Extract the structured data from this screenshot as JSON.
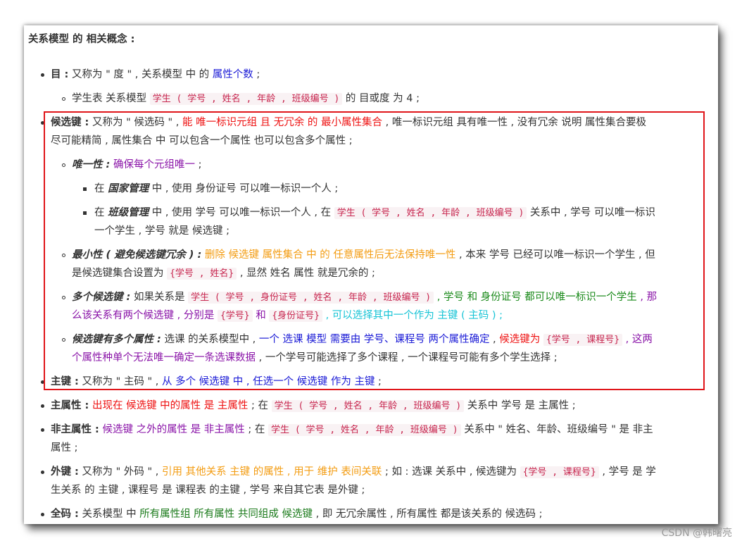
{
  "heading": "关系模型 的 相关概念 :",
  "degree": {
    "title": "目 :",
    "t1": " 又称为 \" 度 \" , 关系模型 中 的 ",
    "hl": "属性个数",
    "t2": " ;",
    "sub_t1": "学生表 关系模型 ",
    "sub_code": "学生 ( 学号 , 姓名 , 年龄 , 班级编号 )",
    "sub_t2": " 的 目或度 为 4 ;"
  },
  "candidate": {
    "title": "候选键 :",
    "t1": " 又称为 \" 候选码 \" , ",
    "hl": "能 唯一标识元组 且 无冗余 的 最小属性集合",
    "t2": " , 唯一标识元组 具有唯一性 , 没有冗余 说明 属性集合要极",
    "line2": "尽可能精简 , 属性集合 中 可以包含一个属性 也可以包含多个属性 ;",
    "unique": {
      "title": "唯一性 :",
      "hl": " 确保每个元组唯一",
      "t": " ;",
      "ex1_t1": "在 ",
      "ex1_b": "国家管理",
      "ex1_t2": " 中 , 使用 身份证号 可以唯一标识一个人 ;",
      "ex2_t1": "在 ",
      "ex2_b": "班级管理",
      "ex2_t2": " 中 , 使用 学号 可以唯一标识一个人 , 在 ",
      "ex2_code": "学生 ( 学号 , 姓名 , 年龄 , 班级编号 )",
      "ex2_t3": " 关系中 , 学号 可以唯一标识",
      "ex2_line2": "一个学生 , 学号 就是 候选键 ;"
    },
    "minimal": {
      "title": "最小性 ( 避免候选键冗余 ) :",
      "hl": " 删除 候选键 属性集合 中 的 任意属性后无法保持唯一性",
      "t": " , 本来 学号 已经可以唯一标识一个学生 , 但",
      "line2_t1": "是候选键集合设置为 ",
      "line2_code": "{学号 , 姓名}",
      "line2_t2": " , 显然 姓名 属性 就是冗余的 ;"
    },
    "multi": {
      "title": "多个候选键 :",
      "t1": " 如果关系是 ",
      "code": "学生 ( 学号 , 身份证号 , 姓名 , 年龄 , 班级编号 )",
      "green": " , 学号 和 身份证号 都可以唯一标识一个学生",
      "purple1": " , 那",
      "line2_purple": "么该关系有两个候选键 , 分别是 ",
      "code2": "{学号}",
      "and": " 和 ",
      "code3": "{身份证号}",
      "cyan": " , 可以选择其中一个作为 主键 ( 主码 ) ;"
    },
    "multiattr": {
      "title": "候选键有多个属性 :",
      "t1": " 选课 的关系模型中 , ",
      "blue": "一个 选课 模型 需要由 学号、课程号 两个属性确定",
      "t2": " , ",
      "red": "候选键为 ",
      "code": "{学号 , 课程号}",
      "purple": " , 这两",
      "line2_purple": "个属性种单个无法唯一确定一条选课数据",
      "line2_t": " , 一个学号可能选择了多个课程 , 一个课程号可能有多个学生选择 ;"
    }
  },
  "primary": {
    "title": "主键 :",
    "t1": " 又称为 \" 主码 \" , ",
    "hl": "从 多个 候选键 中 , 任选一个 候选键 作为 主键",
    "t2": " ;"
  },
  "prime_attr": {
    "title": "主属性 :",
    "hl": " 出现在 候选键 中的属性 是 主属性",
    "t1": " ; 在 ",
    "code": "学生 ( 学号 , 姓名 , 年龄 , 班级编号 )",
    "t2": " 关系中 学号 是 主属性 ;"
  },
  "nonprime_attr": {
    "title": "非主属性 :",
    "hl": " 候选键 之外的属性 是 非主属性",
    "t1": " ; 在 ",
    "code": "学生 ( 学号 , 姓名 , 年龄 , 班级编号 )",
    "t2": " 关系中 \" 姓名、年龄、班级编号 \" 是 非主",
    "line2": "属性 ;"
  },
  "foreign": {
    "title": "外键 :",
    "t1": " 又称为 \" 外码 \" , ",
    "hl": "引用 其他关系 主键 的属性 , 用于 维护 表间关联",
    "t2": " ; 如 : 选课 关系中 , 候选键为 ",
    "code": "{学号 , 课程号}",
    "t3": " , 学号 是 学",
    "line2": "生关系 的 主键 , 课程号 是 课程表 的主键 , 学号 来自其它表 是外键 ;"
  },
  "allkey": {
    "title": "全码 :",
    "t1": " 关系模型 中 ",
    "hl": "所有属性组 所有属性 共同组成 候选键",
    "t2": " , 即 无冗余属性 , 所有属性 都是该关系的 候选码 ;"
  },
  "watermark": "CSDN @韩曙亮"
}
